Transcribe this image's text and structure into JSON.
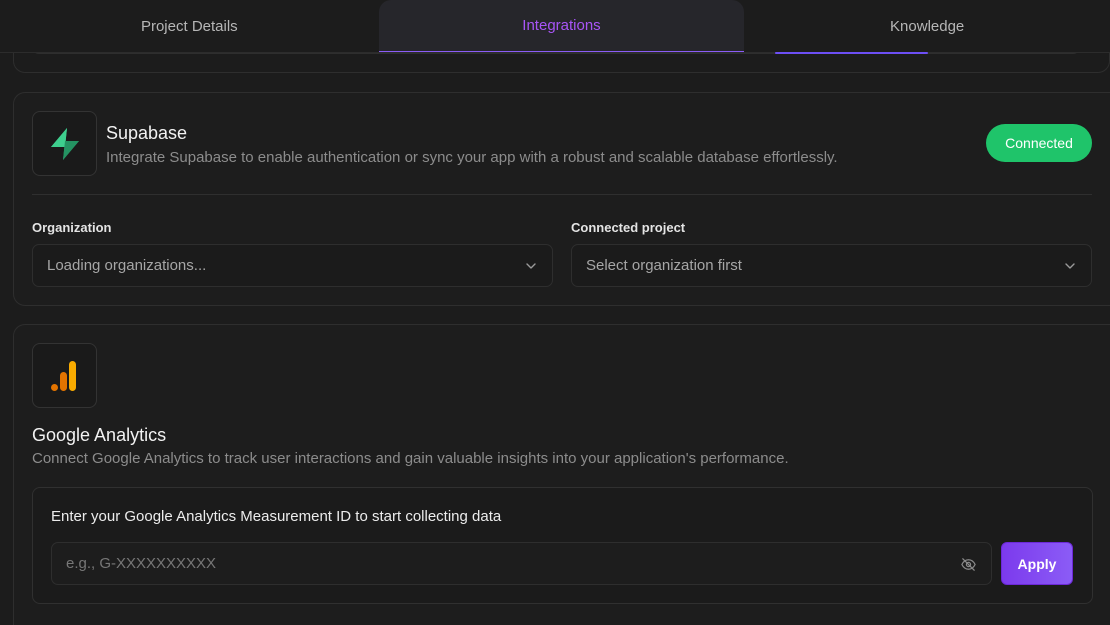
{
  "tabs": [
    {
      "label": "Project Details"
    },
    {
      "label": "Integrations"
    },
    {
      "label": "Knowledge"
    }
  ],
  "accent_color": "#a855f7",
  "supabase": {
    "title": "Supabase",
    "description": "Integrate Supabase to enable authentication or sync your app with a robust and scalable database effortlessly.",
    "status": "Connected",
    "status_color": "#1fc46a",
    "organization": {
      "label": "Organization",
      "value": "Loading organizations..."
    },
    "connected_project": {
      "label": "Connected project",
      "value": "Select organization first"
    }
  },
  "google_analytics": {
    "title": "Google Analytics",
    "description": "Connect Google Analytics to track user interactions and gain valuable insights into your application's performance.",
    "prompt": "Enter your Google Analytics Measurement ID to start collecting data",
    "input_placeholder": "e.g., G-XXXXXXXXXX",
    "input_value": "",
    "apply_label": "Apply"
  }
}
